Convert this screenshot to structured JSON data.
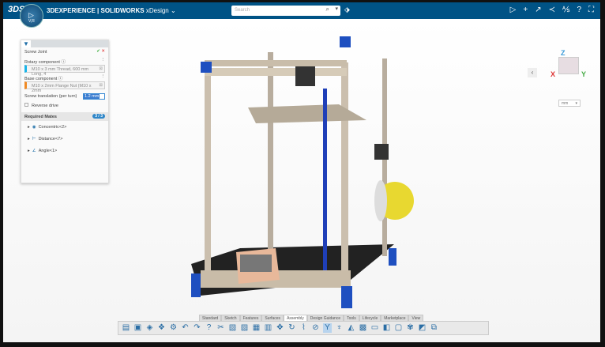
{
  "topbar": {
    "logo": "3DS",
    "compass_label": "V,R",
    "brand": "3DEXPERIENCE",
    "product": "| SOLIDWORKS",
    "app": "xDesign",
    "search_placeholder": "Search"
  },
  "panel": {
    "title": "Screw Joint",
    "rotary_label": "Rotary component",
    "rotary_value": "M10 x 3 mm Thread, 600 mm Long, 4",
    "base_label": "Base component",
    "base_value": "M10 x 2mm Flange Nut (M10 x 2mm",
    "translation_label": "Screw translation (per turn)",
    "translation_value": "1.2 mm",
    "reverse_label": "Reverse drive",
    "required_label": "Required Mates",
    "required_count": "3 / 3",
    "mates": [
      "Concentric<2>",
      "Distance<7>",
      "Angle<1>"
    ]
  },
  "navcube": {
    "z": "Z",
    "x": "X",
    "y": "Y"
  },
  "units": "mm",
  "tabs": [
    "Standard",
    "Sketch",
    "Features",
    "Surfaces",
    "Assembly",
    "Design Guidance",
    "Tools",
    "Lifecycle",
    "Marketplace",
    "View"
  ],
  "active_tab": "Assembly"
}
